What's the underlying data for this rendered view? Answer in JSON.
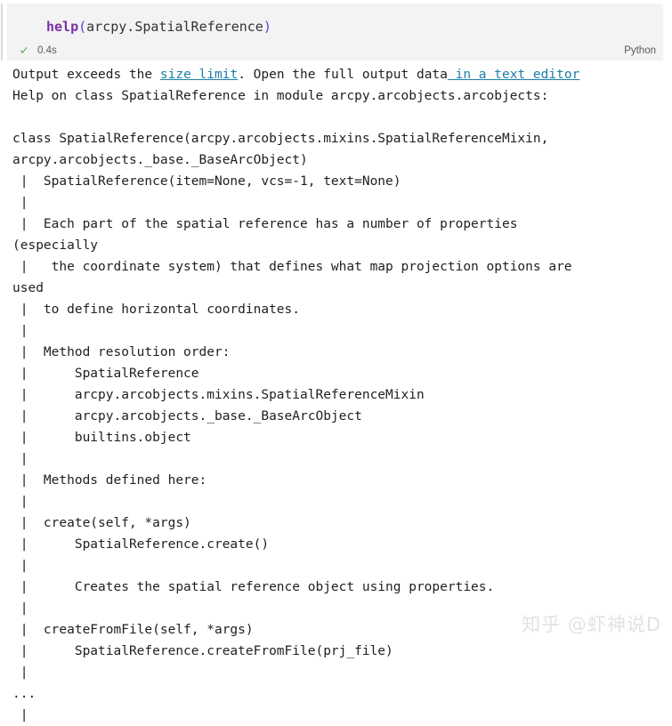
{
  "cell": {
    "code": {
      "function_name": "help",
      "open_paren": "(",
      "argument": "arcpy.SpatialReference",
      "close_paren": ")",
      "full_text": "help(arcpy.SpatialReference)"
    },
    "status": {
      "check_icon": "check-icon",
      "execution_time": "0.4s",
      "kernel": "Python"
    }
  },
  "output": {
    "size_limit_notice": {
      "prefix": "Output exceeds the ",
      "link_size_limit": "size limit",
      "middle": ". Open the full output data",
      "link_text_editor": " in a text editor",
      "full_text": "Output exceeds the size limit. Open the full output data in a text editor"
    },
    "text": "Help on class SpatialReference in module arcpy.arcobjects.arcobjects:\n\nclass SpatialReference(arcpy.arcobjects.mixins.SpatialReferenceMixin,\narcpy.arcobjects._base._BaseArcObject)\n |  SpatialReference(item=None, vcs=-1, text=None)\n |  \n |  Each part of the spatial reference has a number of properties\n(especially\n |   the coordinate system) that defines what map projection options are\nused\n |  to define horizontal coordinates.\n |  \n |  Method resolution order:\n |      SpatialReference\n |      arcpy.arcobjects.mixins.SpatialReferenceMixin\n |      arcpy.arcobjects._base._BaseArcObject\n |      builtins.object\n |  \n |  Methods defined here:\n |  \n |  create(self, *args)\n |      SpatialReference.create()\n |      \n |      Creates the spatial reference object using properties.\n |  \n |  createFromFile(self, *args)\n |      SpatialReference.createFromFile(prj_file)\n |  \n...\n |  "
  },
  "watermark": {
    "text": "知乎 @虾神说D"
  },
  "colors": {
    "cell_background": "#f3f3f3",
    "link": "#1a7fa8",
    "success_check": "#4a9c4a",
    "keyword_purple": "#7b2fa8",
    "punctuation_blue": "#5c41d6",
    "output_text": "#1f1f1f"
  }
}
